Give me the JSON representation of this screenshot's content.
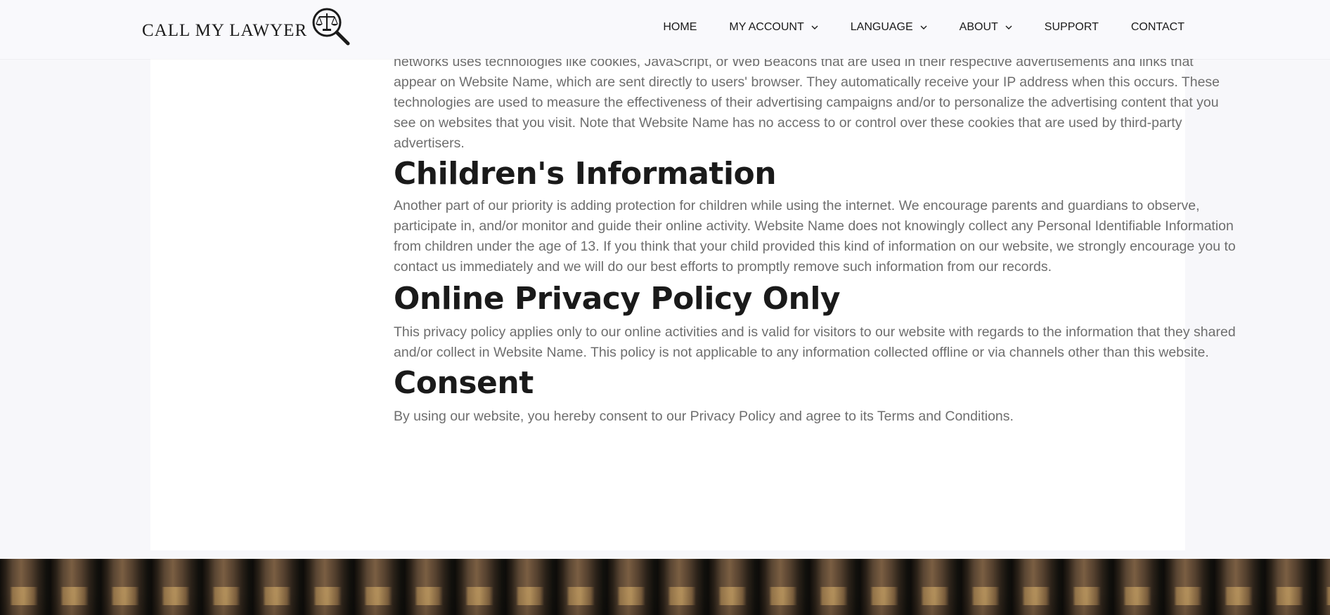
{
  "header": {
    "logo_text": "CALL MY LAWYER",
    "logo_icon": "scales-magnifier-icon",
    "nav": [
      {
        "label": "HOME",
        "has_dropdown": false
      },
      {
        "label": "MY ACCOUNT",
        "has_dropdown": true
      },
      {
        "label": "LANGUAGE",
        "has_dropdown": true
      },
      {
        "label": "ABOUT",
        "has_dropdown": true
      },
      {
        "label": "SUPPORT",
        "has_dropdown": false
      },
      {
        "label": "CONTACT",
        "has_dropdown": false
      }
    ]
  },
  "content": {
    "intro_paragraph": "networks uses technologies like cookies, JavaScript, or Web Beacons that are used in their respective advertisements and links that appear on Website Name, which are sent directly to users' browser. They automatically receive your IP address when this occurs. These technologies are used to measure the effectiveness of their advertising campaigns and/or to personalize the advertising content that you see on websites that you visit. Note that Website Name has no access to or control over these cookies that are used by third-party advertisers.",
    "sections": [
      {
        "heading": "Children's Information",
        "body": "Another part of our priority is adding protection for children while using the internet. We encourage parents and guardians to observe, participate in, and/or monitor and guide their online activity. Website Name does not knowingly collect any Personal Identifiable Information from children under the age of 13. If you think that your child provided this kind of information on our website, we strongly encourage you to contact us immediately and we will do our best efforts to promptly remove such information from our records."
      },
      {
        "heading": "Online Privacy Policy Only",
        "body": "This privacy policy applies only to our online activities and is valid for visitors to our website with regards to the information that they shared and/or collect in Website Name. This policy is not applicable to any information collected offline or via channels other than this website."
      },
      {
        "heading": "Consent",
        "body": "By using our website, you hereby consent to our Privacy Policy and agree to its Terms and Conditions."
      }
    ]
  },
  "footer": {
    "background_image": "bookshelf-photo"
  },
  "colors": {
    "header_bg": "#f9f9fc",
    "page_bg": "#f7f7fa",
    "card_bg": "#ffffff",
    "heading": "#1a1a1a",
    "body_text": "#6e6e6e"
  }
}
